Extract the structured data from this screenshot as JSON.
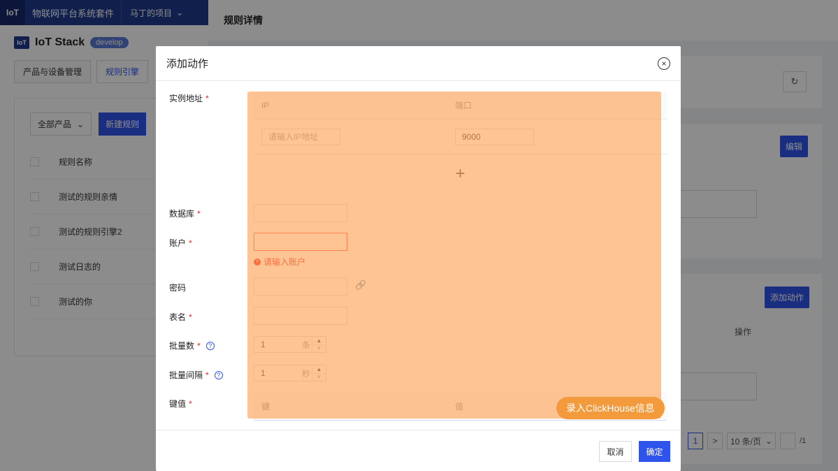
{
  "topbar": {
    "logo": "IoT",
    "system_name": "物联网平台系统套件",
    "project": "马丁的项目"
  },
  "brand": {
    "name": "IoT Stack",
    "badge": "develop",
    "logo": "IoT"
  },
  "tabs": [
    {
      "label": "产品与设备管理"
    },
    {
      "label": "规则引擎"
    }
  ],
  "list": {
    "product_filter": "全部产品",
    "new_rule_button": "新建规则",
    "column_header": "规则名称",
    "rows": [
      "测试的规则亲情",
      "测试的规则引擎2",
      "测试日志的",
      "测试的你"
    ]
  },
  "detail": {
    "title": "规则详情",
    "edit_button": "编辑",
    "add_action_button": "添加动作",
    "operation_header": "操作",
    "pagination": {
      "current_page": "1",
      "page_size": "10 条/页",
      "total": "/1"
    }
  },
  "modal": {
    "title": "添加动作",
    "fields": {
      "instance_address": "实例地址",
      "database": "数据库",
      "account": "账户",
      "password": "密码",
      "table_name": "表名",
      "batch_size": "批量数",
      "batch_interval": "批量间隔",
      "key_value": "键值"
    },
    "ip_table": {
      "col_ip": "IP",
      "col_port": "端口",
      "ip_placeholder": "请输入IP地址",
      "port_value": "9000",
      "add_symbol": "+"
    },
    "account_error": "请输入账户",
    "batch_size": {
      "value": "1",
      "unit": "条"
    },
    "batch_interval": {
      "value": "1",
      "unit": "秒"
    },
    "kv_table": {
      "col_key": "键",
      "col_value": "值"
    },
    "highlight_label": "录入ClickHouse信息",
    "cancel": "取消",
    "confirm": "确定"
  },
  "colors": {
    "primary": "#2f54eb",
    "highlight": "#f39a3d",
    "error": "#f5222d",
    "topbar": "#1f3a8a"
  }
}
